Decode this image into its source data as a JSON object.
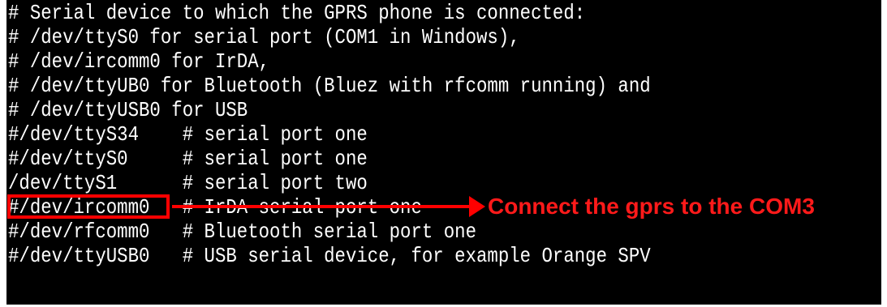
{
  "terminal": {
    "lines": [
      "# Serial device to which the GPRS phone is connected:",
      "# /dev/ttyS0 for serial port (COM1 in Windows),",
      "# /dev/ircomm0 for IrDA,",
      "# /dev/ttyUB0 for Bluetooth (Bluez with rfcomm running) and",
      "# /dev/ttyUSB0 for USB",
      "#/dev/ttyS34    # serial port one",
      "#/dev/ttyS0     # serial port one",
      "/dev/ttyS1      # serial port two",
      "#/dev/ircomm0   # IrDA serial port one",
      "#/dev/rfcomm0   # Bluetooth serial port one",
      "#/dev/ttyUSB0   # USB serial device, for example Orange SPV"
    ]
  },
  "annotation": {
    "text": "Connect the gprs to the COM3",
    "color": "#ff1a1a"
  }
}
